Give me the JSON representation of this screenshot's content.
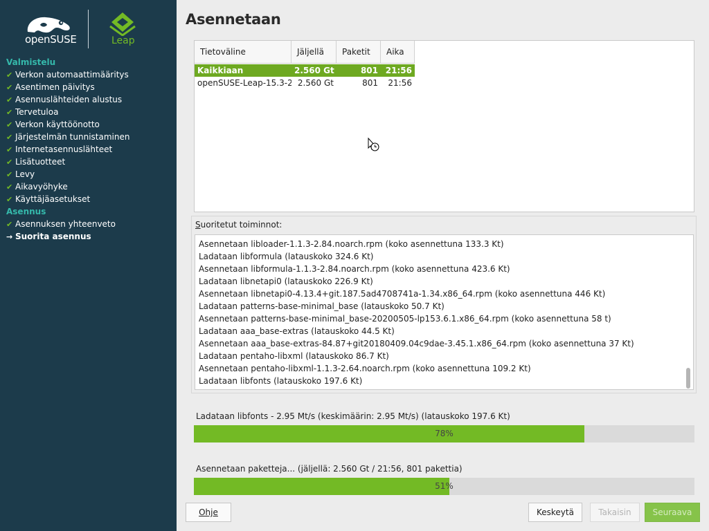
{
  "sidebar": {
    "opensuse_logo_text": "openSUSE",
    "leap_logo_text": "Leap",
    "groups": [
      {
        "title": "Valmistelu",
        "steps": [
          {
            "label": "Verkon automaattimääritys",
            "state": "done"
          },
          {
            "label": "Asentimen päivitys",
            "state": "done"
          },
          {
            "label": "Asennuslähteiden alustus",
            "state": "done"
          },
          {
            "label": "Tervetuloa",
            "state": "done"
          },
          {
            "label": "Verkon käyttöönotto",
            "state": "done"
          },
          {
            "label": "Järjestelmän tunnistaminen",
            "state": "done"
          },
          {
            "label": "Internetasennuslähteet",
            "state": "done"
          },
          {
            "label": "Lisätuotteet",
            "state": "done"
          },
          {
            "label": "Levy",
            "state": "done"
          },
          {
            "label": "Aikavyöhyke",
            "state": "done"
          },
          {
            "label": "Käyttäjäasetukset",
            "state": "done"
          }
        ]
      },
      {
        "title": "Asennus",
        "steps": [
          {
            "label": "Asennuksen yhteenveto",
            "state": "done"
          },
          {
            "label": "Suorita asennus",
            "state": "current"
          }
        ]
      }
    ]
  },
  "main": {
    "title": "Asennetaan",
    "media_table": {
      "columns": [
        "Tietoväline",
        "Jäljellä",
        "Paketit",
        "Aika"
      ],
      "rows": [
        [
          "Kaikkiaan",
          "2.560 Gt",
          "801",
          "21:56"
        ],
        [
          "openSUSE-Leap-15.3-2",
          "2.560 Gt",
          "801",
          "21:56"
        ]
      ],
      "selected_row": 0
    },
    "log": {
      "label_underlined": "S",
      "label_rest": "uoritetut toiminnot:",
      "lines": [
        "Asennetaan libloader-1.1.3-2.84.noarch.rpm (koko asennettuna 133.3 Kt)",
        "Ladataan libformula (latauskoko 324.6 Kt)",
        "Asennetaan libformula-1.1.3-2.84.noarch.rpm (koko asennettuna 423.6 Kt)",
        "Ladataan libnetapi0 (latauskoko 226.9 Kt)",
        "Asennetaan libnetapi0-4.13.4+git.187.5ad4708741a-1.34.x86_64.rpm (koko asennettuna 446 Kt)",
        "Ladataan patterns-base-minimal_base (latauskoko 50.7 Kt)",
        "Asennetaan patterns-base-minimal_base-20200505-lp153.6.1.x86_64.rpm (koko asennettuna 58 t)",
        "Ladataan aaa_base-extras (latauskoko 44.5 Kt)",
        "Asennetaan aaa_base-extras-84.87+git20180409.04c9dae-3.45.1.x86_64.rpm (koko asennettuna 37 Kt)",
        "Ladataan pentaho-libxml (latauskoko 86.7 Kt)",
        "Asennetaan pentaho-libxml-1.1.3-2.64.noarch.rpm (koko asennettuna 109.2 Kt)",
        "Ladataan libfonts (latauskoko 197.6 Kt)"
      ]
    },
    "download_progress": {
      "label": "Ladataan libfonts - 2.95 Mt/s (keskimäärin: 2.95 Mt/s) (latauskoko 197.6 Kt)",
      "percent": 78,
      "text": "78%"
    },
    "install_progress": {
      "label": "Asennetaan paketteja... (jäljellä: 2.560 Gt / 21:56, 801 pakettia)",
      "percent": 51,
      "text": "51%"
    }
  },
  "buttons": {
    "help": "Ohje",
    "abort": "Keskeytä",
    "back": "Takaisin",
    "next": "Seuraava"
  },
  "colors": {
    "sidebar_bg": "#1c3b4b",
    "accent_green": "#73ba25",
    "group_title": "#35b9ab"
  }
}
